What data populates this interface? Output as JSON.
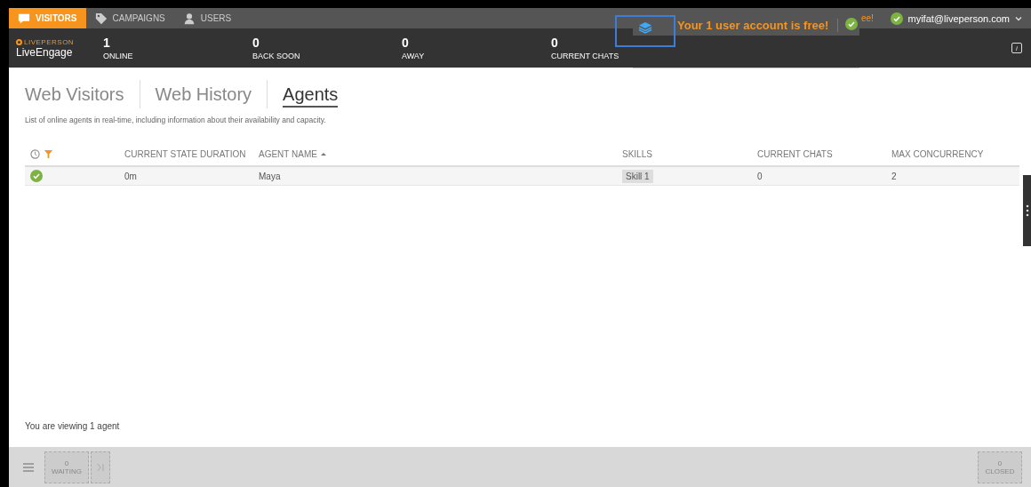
{
  "nav": {
    "tabs": [
      {
        "label": "VISITORS",
        "selected": true,
        "kind": "chat"
      },
      {
        "label": "CAMPAIGNS",
        "selected": false,
        "kind": "tag"
      },
      {
        "label": "USERS",
        "selected": false,
        "kind": "user"
      }
    ]
  },
  "brand": {
    "company": "LIVEPERSON",
    "product": "LiveEngage"
  },
  "stats": [
    {
      "value": "1",
      "label": "ONLINE"
    },
    {
      "value": "0",
      "label": "BACK SOON"
    },
    {
      "value": "0",
      "label": "AWAY"
    },
    {
      "value": "0",
      "label": "CURRENT CHATS"
    }
  ],
  "banner": {
    "message": "Your 1 user account is free!",
    "behind_text": "ee!"
  },
  "account": {
    "email": "myifat@liveperson.com",
    "online": true
  },
  "info_label": "i",
  "page_tabs": [
    {
      "label": "Web Visitors",
      "selected": false
    },
    {
      "label": "Web History",
      "selected": false
    },
    {
      "label": "Agents",
      "selected": true
    }
  ],
  "description": "List of online agents in real-time, including information about their availability and capacity.",
  "table": {
    "columns": [
      {
        "label": "CURRENT STATE DURATION",
        "sorted": false
      },
      {
        "label": "AGENT NAME",
        "sorted": true
      },
      {
        "label": "SKILLS",
        "sorted": false
      },
      {
        "label": "CURRENT CHATS",
        "sorted": false
      },
      {
        "label": "MAX CONCURRENCY",
        "sorted": false
      }
    ],
    "rows": [
      {
        "online": true,
        "duration": "0m",
        "agent": "Maya",
        "skills": [
          "Skill 1"
        ],
        "current_chats": "0",
        "max_concurrency": "2"
      }
    ]
  },
  "footer": "You are viewing 1 agent",
  "bottom": {
    "waiting": {
      "count": "0",
      "label": "WAITING"
    },
    "closed": {
      "count": "0",
      "label": "CLOSED"
    }
  }
}
